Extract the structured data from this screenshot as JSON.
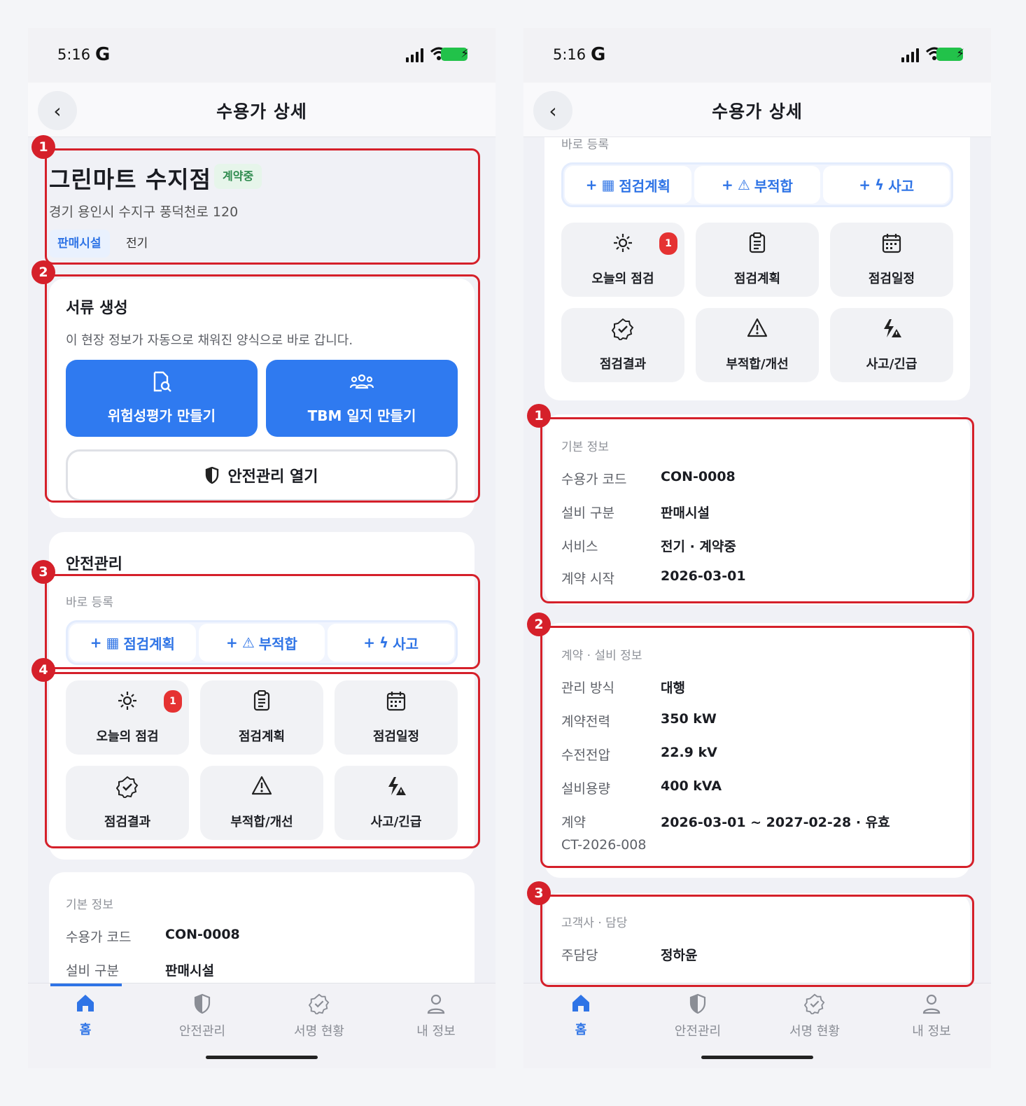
{
  "status": {
    "time": "5:16",
    "g": "G"
  },
  "header": {
    "title": "수용가 상세"
  },
  "left": {
    "store": {
      "name": "그린마트 수지점",
      "badge": "계약중",
      "address": "경기 용인시 수지구 풍덕천로 120",
      "tags": [
        "판매시설",
        "전기"
      ]
    },
    "docs": {
      "title": "서류 생성",
      "desc": "이 현장 정보가 자동으로 채워진 양식으로 바로 갑니다.",
      "btn_risk": "위험성평가 만들기",
      "btn_tbm": "TBM 일지 만들기",
      "btn_safety": "안전관리 열기"
    },
    "safety": {
      "title": "안전관리",
      "quick_caption": "바로 등록"
    },
    "basic": {
      "caption": "기본 정보",
      "rows": [
        {
          "label": "수용가 코드",
          "value": "CON-0008"
        },
        {
          "label": "설비 구분",
          "value": "판매시설"
        }
      ]
    }
  },
  "quick": [
    "점검계획",
    "부적합",
    "사고"
  ],
  "tiles": [
    {
      "label": "오늘의 점검",
      "icon": "sun-icon",
      "badge": "1"
    },
    {
      "label": "점검계획",
      "icon": "clipboard-icon"
    },
    {
      "label": "점검일정",
      "icon": "calendar-icon"
    },
    {
      "label": "점검결과",
      "icon": "check-badge-icon"
    },
    {
      "label": "부적합/개선",
      "icon": "warning-icon"
    },
    {
      "label": "사고/긴급",
      "icon": "bolt-warning-icon"
    }
  ],
  "right": {
    "quick_caption": "바로 등록",
    "basic": {
      "caption": "기본 정보",
      "rows": [
        {
          "label": "수용가 코드",
          "value": "CON-0008"
        },
        {
          "label": "설비 구분",
          "value": "판매시설"
        },
        {
          "label": "서비스",
          "value": "전기 · 계약중"
        },
        {
          "label": "계약 시작",
          "value": "2026-03-01"
        }
      ]
    },
    "contract": {
      "caption": "계약 · 설비 정보",
      "rows": [
        {
          "label": "관리 방식",
          "value": "대행"
        },
        {
          "label": "계약전력",
          "value": "350 kW"
        },
        {
          "label": "수전전압",
          "value": "22.9 kV"
        },
        {
          "label": "설비용량",
          "value": "400 kVA"
        },
        {
          "label": "계약",
          "value": "2026-03-01 ~ 2027-02-28 · 유효"
        }
      ],
      "contract_no": "CT-2026-008"
    },
    "customer": {
      "caption": "고객사 · 담당",
      "rows": [
        {
          "label": "주담당",
          "value": "정하윤"
        }
      ]
    }
  },
  "nav": [
    "홈",
    "안전관리",
    "서명 현황",
    "내 정보"
  ],
  "markers": {
    "left": [
      "1",
      "2",
      "3",
      "4"
    ],
    "right": [
      "1",
      "2",
      "3"
    ]
  },
  "colors": {
    "accent": "#2f74e6",
    "highlight": "#d5202a",
    "badge_green": "#2e8b4e"
  }
}
